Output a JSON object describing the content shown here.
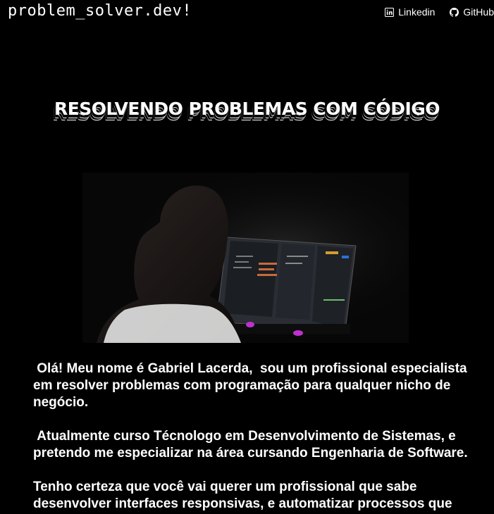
{
  "header": {
    "brand": "problem_solver.dev!",
    "links": [
      {
        "label": "Linkedin",
        "icon": "linkedin-icon"
      },
      {
        "label": "GitHub",
        "icon": "github-icon"
      }
    ]
  },
  "hero": {
    "title": "RESOLVENDO PROBLEMAS COM CÓDIGO",
    "image_alt_subject": "person-at-monitor-photo"
  },
  "bio": {
    "paragraphs": [
      " Olá! Meu nome é Gabriel Lacerda,  sou um profissional especialista em resolver problemas com programação para qualquer nicho de negócio.",
      " Atualmente curso Técnologo em Desenvolvimento de Sistemas, e pretendo me especializar na área cursando Engenharia de Software.",
      "Tenho certeza que você vai querer um profissional que sabe desenvolver interfaces responsivas, e automatizar processos que"
    ]
  }
}
